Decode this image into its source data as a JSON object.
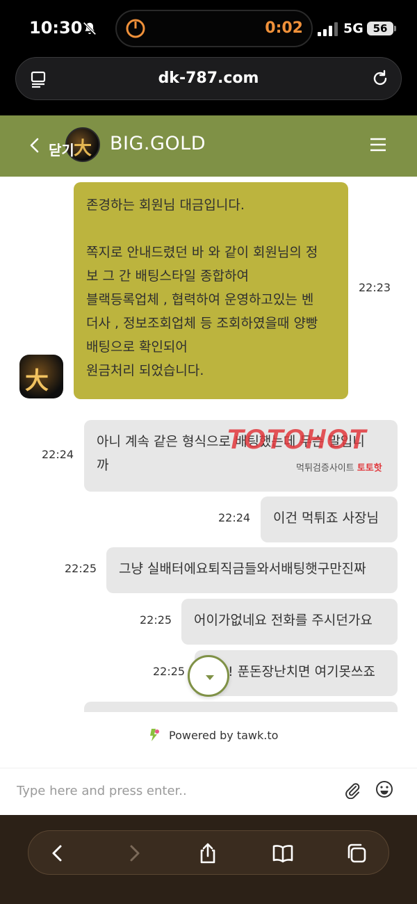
{
  "status_bar": {
    "time": "10:30",
    "timer": "0:02",
    "network": "5G",
    "battery": "56"
  },
  "browser": {
    "url": "dk-787.com"
  },
  "chat_header": {
    "close_label": "닫기",
    "brand": "BIG.GOLD",
    "accent_color": "#7f9146"
  },
  "messages": [
    {
      "sender": "agent",
      "time": "22:23",
      "lines": [
        "존경하는 회원님 대금입니다.",
        "",
        "쪽지로 안내드렸던 바 와 같이 회원님의 정",
        "보 그 간 배팅스타일 종합하여",
        "블랙등록업체 , 협력하여 운영하고있는 벤",
        "더사 , 정보조회업체 등 조회하였을때 양빵",
        "배팅으로 확인되어",
        "원금처리 되었습니다."
      ]
    },
    {
      "sender": "visitor",
      "time": "22:24",
      "lines": [
        "아니 계속 같은 형식으로 배팅했는데 무슨 말입니",
        "까"
      ]
    },
    {
      "sender": "visitor",
      "time": "22:24",
      "lines": [
        "이건 먹튀죠 사장님"
      ]
    },
    {
      "sender": "visitor",
      "time": "22:25",
      "lines": [
        "그냥 실배터에요퇴직금들와서배팅햇구만진짜"
      ]
    },
    {
      "sender": "visitor",
      "time": "22:25",
      "lines": [
        "어이가없네요 전화를 주시던가요"
      ]
    },
    {
      "sender": "visitor",
      "time": "22:25",
      "lines": [
        "! 푼돈장난치면 여기못쓰죠"
      ]
    }
  ],
  "watermark": {
    "logo": "TOTOHOT",
    "sub_prefix": "먹튀검증사이트",
    "sub_brand": "토토핫"
  },
  "powered_by": "Powered by tawk.to",
  "composer": {
    "placeholder": "Type here and press enter.."
  },
  "icons": {
    "bell": "bell-slash-icon",
    "menu": "hamburger-icon",
    "attach": "paperclip-icon",
    "emoji": "smiley-icon",
    "scroll": "chevron-down-icon"
  }
}
